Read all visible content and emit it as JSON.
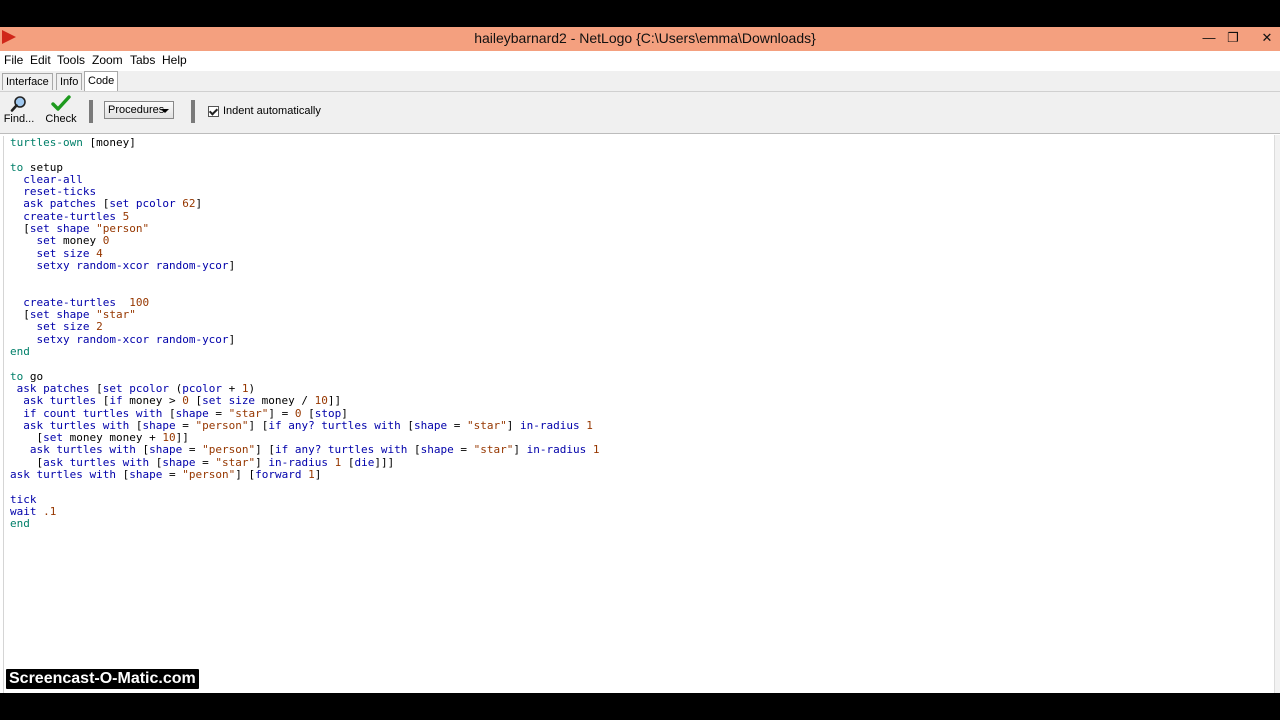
{
  "window": {
    "title": "haileybarnard2 - NetLogo {C:\\Users\\emma\\Downloads}",
    "controls": {
      "minimize": "—",
      "maximize": "❐",
      "close": "✕"
    }
  },
  "menu": {
    "file": "File",
    "edit": "Edit",
    "tools": "Tools",
    "zoom": "Zoom",
    "tabs": "Tabs",
    "help": "Help"
  },
  "tabs": {
    "interface": "Interface",
    "info": "Info",
    "code": "Code",
    "active": "Code"
  },
  "toolbar": {
    "find_label": "Find...",
    "check_label": "Check",
    "procedures_label": "Procedures",
    "indent_label": "Indent automatically",
    "indent_checked": true
  },
  "code": {
    "l1a": "turtles-own",
    "l1b": " [money]",
    "l3a": "to",
    "l3b": " setup",
    "l4": "  clear-all",
    "l5": "  reset-ticks",
    "l6a": "  ask patches",
    "l6b": " [",
    "l6c": "set pcolor",
    "l6d": " ",
    "l6e": "62",
    "l6f": "]",
    "l7a": "  create-turtles",
    "l7b": " ",
    "l7c": "5",
    "l8a": "  [",
    "l8b": "set shape",
    "l8c": " ",
    "l8d": "\"person\"",
    "l9a": "    ",
    "l9b": "set",
    "l9c": " money ",
    "l9d": "0",
    "l10a": "    ",
    "l10b": "set size",
    "l10c": " ",
    "l10d": "4",
    "l11a": "    ",
    "l11b": "setxy random-xcor random-ycor",
    "l11c": "]",
    "l14a": "  create-turtles",
    "l14b": "  ",
    "l14c": "100",
    "l15a": "  [",
    "l15b": "set shape",
    "l15c": " ",
    "l15d": "\"star\"",
    "l16a": "    ",
    "l16b": "set size",
    "l16c": " ",
    "l16d": "2",
    "l17a": "    ",
    "l17b": "setxy random-xcor random-ycor",
    "l17c": "]",
    "l18": "end",
    "l20a": "to",
    "l20b": " go",
    "l21a": " ask patches",
    "l21b": " [",
    "l21c": "set pcolor",
    "l21d": " (",
    "l21e": "pcolor",
    "l21f": " + ",
    "l21g": "1",
    "l21h": ")",
    "l22a": "  ask turtles",
    "l22b": " [",
    "l22c": "if",
    "l22d": " money > ",
    "l22e": "0",
    "l22f": " [",
    "l22g": "set size",
    "l22h": " money / ",
    "l22i": "10",
    "l22j": "]]",
    "l23a": "  if count turtles with",
    "l23b": " [",
    "l23c": "shape",
    "l23d": " = ",
    "l23e": "\"star\"",
    "l23f": "] = ",
    "l23g": "0",
    "l23h": " [",
    "l23i": "stop",
    "l23j": "]",
    "l24a": "  ask turtles with",
    "l24b": " [",
    "l24c": "shape",
    "l24d": " = ",
    "l24e": "\"person\"",
    "l24f": "] [",
    "l24g": "if any? turtles with",
    "l24h": " [",
    "l24i": "shape",
    "l24j": " = ",
    "l24k": "\"star\"",
    "l24l": "] ",
    "l24m": "in-radius",
    "l24n": " ",
    "l24o": "1",
    "l25a": "    [",
    "l25b": "set",
    "l25c": " money money + ",
    "l25d": "10",
    "l25e": "]]",
    "l26a": "   ask turtles with",
    "l26b": " [",
    "l26c": "shape",
    "l26d": " = ",
    "l26e": "\"person\"",
    "l26f": "] [",
    "l26g": "if any? turtles with",
    "l26h": " [",
    "l26i": "shape",
    "l26j": " = ",
    "l26k": "\"star\"",
    "l26l": "] ",
    "l26m": "in-radius",
    "l26n": " ",
    "l26o": "1",
    "l27a": "    [",
    "l27b": "ask turtles with",
    "l27c": " [",
    "l27d": "shape",
    "l27e": " = ",
    "l27f": "\"star\"",
    "l27g": "] ",
    "l27h": "in-radius",
    "l27i": " ",
    "l27j": "1",
    "l27k": " [",
    "l27l": "die",
    "l27m": "]]]",
    "l28a": "ask turtles with",
    "l28b": " [",
    "l28c": "shape",
    "l28d": " = ",
    "l28e": "\"person\"",
    "l28f": "] [",
    "l28g": "forward",
    "l28h": " ",
    "l28i": "1",
    "l28j": "]",
    "l30": "tick",
    "l31a": "wait",
    "l31b": " ",
    "l31c": ".1",
    "l32": "end"
  },
  "watermark": "Screencast-O-Matic.com",
  "colors": {
    "titlebar": "#f4a07f",
    "keyword": "#007f69",
    "primitive": "#0000aa",
    "constant": "#963700"
  }
}
